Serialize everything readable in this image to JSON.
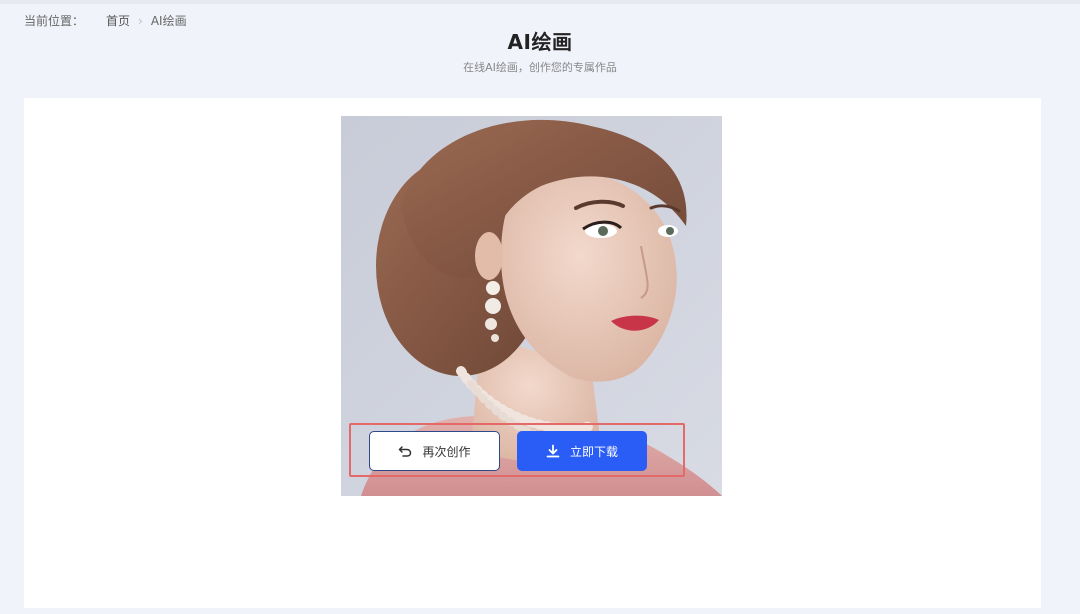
{
  "breadcrumb": {
    "label": "当前位置：",
    "home": "首页",
    "separator": "›",
    "current": "AI绘画"
  },
  "header": {
    "title": "AI绘画",
    "subtitle": "在线AI绘画，创作您的专属作品"
  },
  "artwork": {
    "icon": "portrait-image",
    "description_visible": false
  },
  "actions": {
    "recreate_label": "再次创作",
    "recreate_icon": "undo-icon",
    "download_label": "立即下载",
    "download_icon": "download-icon"
  },
  "colors": {
    "accent": "#2a5cf6",
    "highlight_border": "#e46a6a",
    "page_bg": "#f0f3fa"
  }
}
